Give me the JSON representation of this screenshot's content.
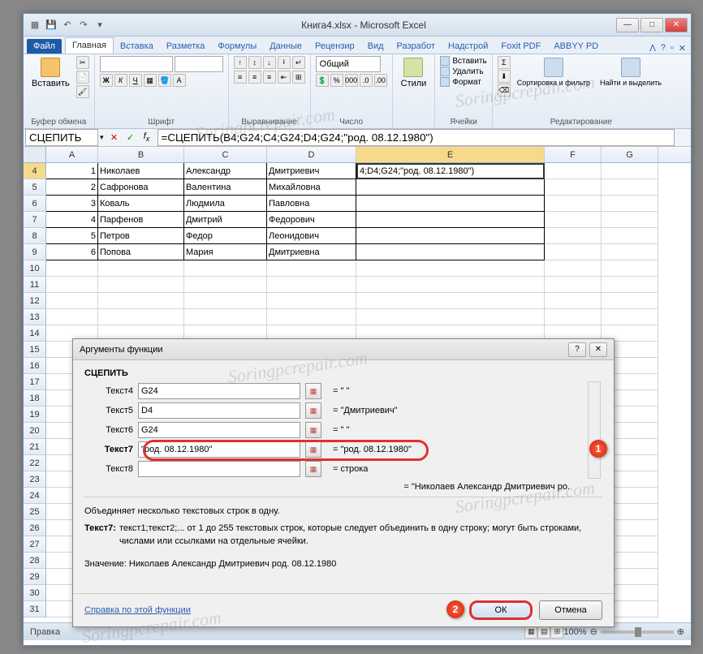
{
  "window": {
    "title": "Книга4.xlsx - Microsoft Excel",
    "qat_save": "💾",
    "qat_undo": "↶",
    "qat_redo": "↷"
  },
  "tabs": {
    "file": "Файл",
    "home": "Главная",
    "insert": "Вставка",
    "layout": "Разметка",
    "formulas": "Формулы",
    "data": "Данные",
    "review": "Рецензир",
    "view": "Вид",
    "developer": "Разработ",
    "addins": "Надстрой",
    "foxit": "Foxit PDF",
    "abbyy": "ABBYY PD"
  },
  "ribbon": {
    "paste": "Вставить",
    "clipboard": "Буфер обмена",
    "font": "Шрифт",
    "font_combo": "",
    "size_combo": "",
    "alignment": "Выравнивание",
    "number": "Число",
    "num_format": "Общий",
    "styles": "Стили",
    "cells": "Ячейки",
    "cell_insert": "Вставить",
    "cell_delete": "Удалить",
    "cell_format": "Формат",
    "editing": "Редактирование",
    "sort": "Сортировка и фильтр",
    "find": "Найти и выделить"
  },
  "formula_bar": {
    "name_box": "СЦЕПИТЬ",
    "formula": "=СЦЕПИТЬ(B4;G24;C4;G24;D4;G24;\"род. 08.12.1980\")"
  },
  "columns": [
    "A",
    "B",
    "C",
    "D",
    "E",
    "F",
    "G"
  ],
  "rows_start": 4,
  "grid": {
    "data": [
      {
        "a": "1",
        "b": "Николаев",
        "c": "Александр",
        "d": "Дмитриевич",
        "e": "4;D4;G24;\"род. 08.12.1980\")"
      },
      {
        "a": "2",
        "b": "Сафронова",
        "c": "Валентина",
        "d": "Михайловна",
        "e": ""
      },
      {
        "a": "3",
        "b": "Коваль",
        "c": "Людмила",
        "d": "Павловна",
        "e": ""
      },
      {
        "a": "4",
        "b": "Парфенов",
        "c": "Дмитрий",
        "d": "Федорович",
        "e": ""
      },
      {
        "a": "5",
        "b": "Петров",
        "c": "Федор",
        "d": "Леонидович",
        "e": ""
      },
      {
        "a": "6",
        "b": "Попова",
        "c": "Мария",
        "d": "Дмитриевна",
        "e": ""
      }
    ],
    "empty_rows": [
      10,
      11,
      12,
      13,
      14,
      15,
      16,
      17,
      18,
      19,
      20,
      21,
      22,
      23,
      24,
      25,
      26,
      27,
      28,
      29,
      30,
      31
    ]
  },
  "dialog": {
    "title": "Аргументы функции",
    "fn_name": "СЦЕПИТЬ",
    "args": [
      {
        "label": "Текст4",
        "value": "G24",
        "result": "= \" \""
      },
      {
        "label": "Текст5",
        "value": "D4",
        "result": "= \"Дмитриевич\""
      },
      {
        "label": "Текст6",
        "value": "G24",
        "result": "= \" \""
      },
      {
        "label": "Текст7",
        "value": "\"род. 08.12.1980\"",
        "result": "= \"род. 08.12.1980\"",
        "bold": true
      },
      {
        "label": "Текст8",
        "value": "",
        "result": "= строка"
      }
    ],
    "combined": "= \"Николаев Александр Дмитриевич ро.",
    "desc": "Объединяет несколько текстовых строк в одну.",
    "detail_label": "Текст7:",
    "detail_text": "текст1;текст2;... от 1 до 255 текстовых строк, которые следует объединить в одну строку; могут быть строками, числами или ссылками на отдельные ячейки.",
    "value_label": "Значение:",
    "value_text": "Николаев Александр Дмитриевич род. 08.12.1980",
    "help": "Справка по этой функции",
    "ok": "ОК",
    "cancel": "Отмена"
  },
  "status": {
    "mode": "Правка",
    "zoom": "100%"
  },
  "watermark": "Soringpcrepair.com"
}
